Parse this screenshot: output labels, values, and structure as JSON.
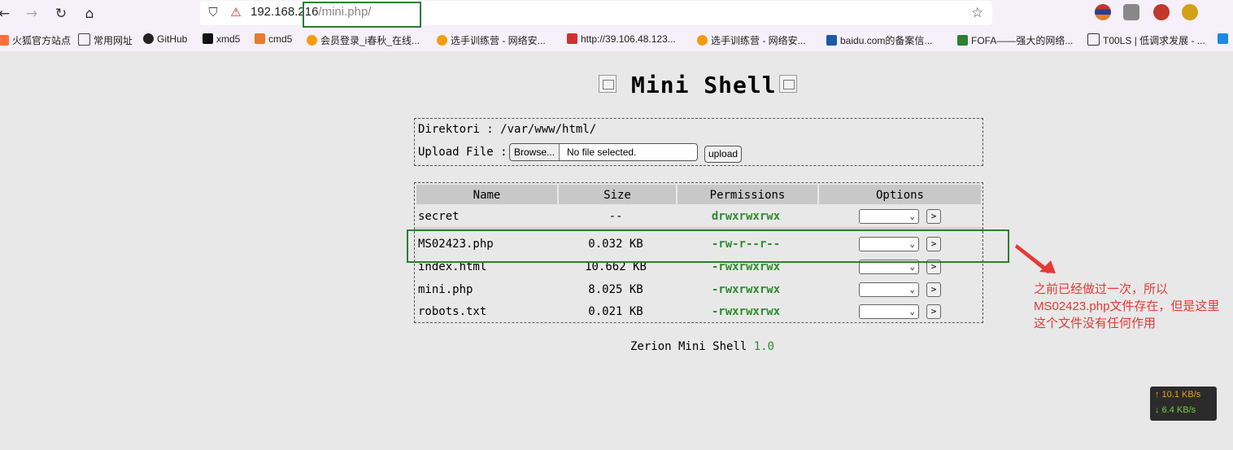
{
  "browser": {
    "url_host": "192.168.2",
    "url_host_rest": "16",
    "url_path": "/mini.php/",
    "icons": {
      "back": "←",
      "forward": "→",
      "reload": "↻",
      "home": "⌂",
      "shield": "⛉",
      "insecure": "⚠",
      "star": "☆"
    }
  },
  "bookmarks": [
    {
      "label": "火狐官方站点",
      "color": "#ff7139"
    },
    {
      "label": "常用网址",
      "color": "#ffffff"
    },
    {
      "label": "GitHub",
      "color": "#222222"
    },
    {
      "label": "xmd5",
      "color": "#b71c1c"
    },
    {
      "label": "cmd5",
      "color": "#e57c2e"
    },
    {
      "label": "会员登录_i春秋_在线...",
      "color": "#f39c12"
    },
    {
      "label": "选手训练营 - 网络安...",
      "color": "#f39c12"
    },
    {
      "label": "http://39.106.48.123...",
      "color": "#d32f2f"
    },
    {
      "label": "选手训练营 - 网络安...",
      "color": "#f39c12"
    },
    {
      "label": "baidu.com的备案信...",
      "color": "#1e5aa8"
    },
    {
      "label": "FOFA——强大的网络...",
      "color": "#2e7d32"
    },
    {
      "label": "T00LS | 低调求发展 - ...",
      "color": "#333333"
    }
  ],
  "page": {
    "title": "Mini Shell",
    "dir_label": "Direktori : ",
    "dir_value": "/var/www/html/",
    "upload_label": "Upload File : ",
    "browse_label": "Browse...",
    "no_file": "No file selected.",
    "upload_button": "upload",
    "table": {
      "headers": [
        "Name",
        "Size",
        "Permissions",
        "Options"
      ],
      "go_label": ">",
      "rows": [
        {
          "name": "secret",
          "size": "--",
          "perm": "drwxrwxrwx"
        },
        {
          "name": "MS02423.php",
          "size": "0.032 KB",
          "perm": "-rw-r--r--"
        },
        {
          "name": "index.html",
          "size": "10.662 KB",
          "perm": "-rwxrwxrwx"
        },
        {
          "name": "mini.php",
          "size": "8.025 KB",
          "perm": "-rwxrwxrwx"
        },
        {
          "name": "robots.txt",
          "size": "0.021 KB",
          "perm": "-rwxrwxrwx"
        }
      ]
    },
    "footer_text": "Zerion Mini Shell ",
    "footer_version": "1.0"
  },
  "annotation": {
    "note": "之前已经做过一次，所以MS02423.php文件存在，但是这里这个文件没有任何作用",
    "color": "#e53935"
  },
  "speed": {
    "up": "↑ 10.1 KB/s",
    "down": "↓ 6.4 KB/s"
  }
}
